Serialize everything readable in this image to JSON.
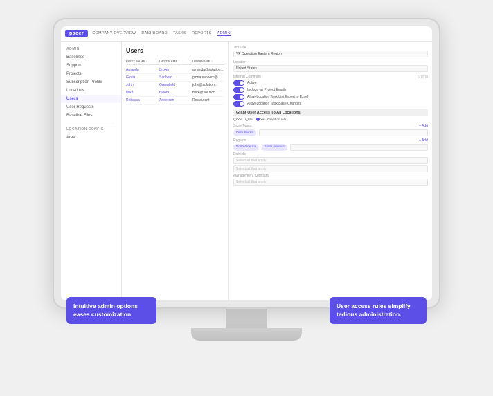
{
  "monitor": {
    "screen_label": "Pacer Admin UI"
  },
  "header": {
    "logo_text": "pacer",
    "nav": [
      "COMPANY OVERVIEW",
      "DASHBOARD",
      "TASKS",
      "REPORTS",
      "ADMIN"
    ]
  },
  "sidebar": {
    "section_label": "ADMIN",
    "items": [
      {
        "label": "Baselines",
        "active": false
      },
      {
        "label": "Support",
        "active": false
      },
      {
        "label": "Projects",
        "active": false
      },
      {
        "label": "Subscription Profile",
        "active": false
      },
      {
        "label": "Locations",
        "active": false
      },
      {
        "label": "Users",
        "active": true
      },
      {
        "label": "User Requests",
        "active": false
      },
      {
        "label": "Baseline Files",
        "active": false
      }
    ],
    "section2_label": "LOCATION CONFIG",
    "items2": [
      {
        "label": "Area",
        "active": false
      }
    ]
  },
  "users_panel": {
    "title": "Users",
    "columns": [
      "FIRST NAME ↑",
      "LAST NAME ↑",
      "USERNAME ↑"
    ],
    "rows": [
      {
        "first": "Amanda",
        "last": "Brown",
        "username": "amanda@solution..."
      },
      {
        "first": "Gloria",
        "last": "Sanborn",
        "username": "gloria.sanborn@..."
      },
      {
        "first": "John",
        "last": "Greenfield",
        "username": "john@solution..."
      },
      {
        "first": "Mike",
        "last": "Bloom",
        "username": "mike@solution..."
      },
      {
        "first": "Rebecca",
        "last": "Anderson",
        "username": "Restaurant"
      }
    ]
  },
  "detail_panel": {
    "job_title_label": "Job Title",
    "job_title_value": "VP Operation Eastern Region",
    "location_label": "Location",
    "location_value": "United States",
    "char_count": "0/1000",
    "internal_comment_label": "Internal Comment",
    "toggles": [
      {
        "label": "Active",
        "on": true
      },
      {
        "label": "Include on Project Emails",
        "on": true
      },
      {
        "label": "Allow Location Task List Export to Excel",
        "on": true
      },
      {
        "label": "Allow Location Task Base Changes",
        "on": true
      }
    ],
    "grant_access_label": "Grant User Access To All Locations",
    "radio_options": [
      "Yes",
      "No",
      "Yes, based on role"
    ],
    "selected_radio": 2,
    "add_label": "+ Add",
    "store_types_label": "Store Types",
    "store_type_tags": [
      "Palm Stores"
    ],
    "regions_label": "Regions",
    "region_tags": [
      "North America",
      "South America"
    ],
    "districts_label": "Districts",
    "districts_placeholder": "Select all that apply",
    "locations_placeholder": "Select all that apply",
    "management_company_label": "Management Company",
    "management_placeholder": "Select all that apply"
  },
  "callouts": {
    "left_text": "Intuitive admin options eases customization.",
    "right_text": "User access rules simplify tedious administration."
  }
}
